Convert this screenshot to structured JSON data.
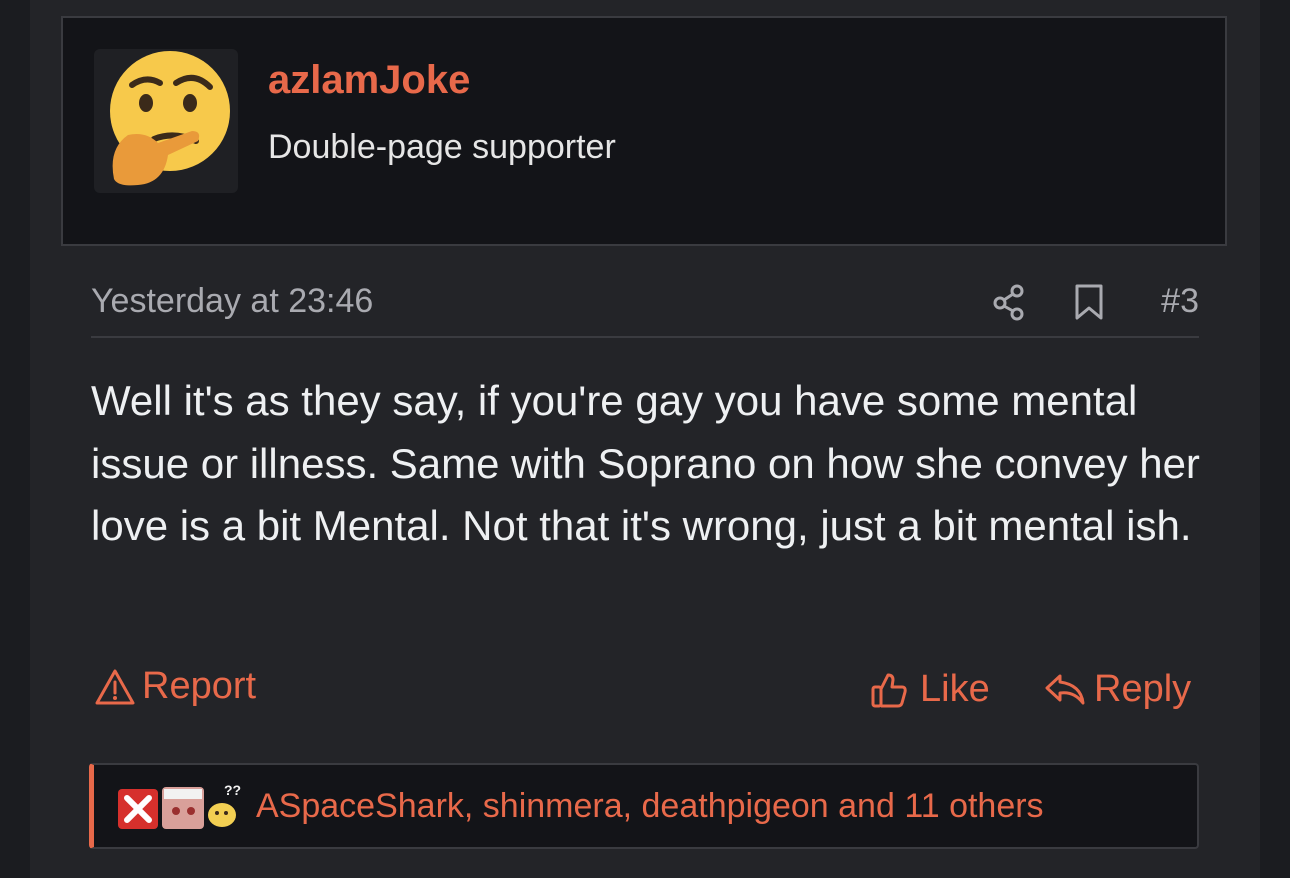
{
  "user": {
    "avatar_icon": "thinking-face-emoji",
    "username": "azlamJoke",
    "title": "Double-page supporter"
  },
  "post": {
    "timestamp": "Yesterday at 23:46",
    "share_icon": "share-icon",
    "bookmark_icon": "bookmark-icon",
    "number": "#3",
    "message": "Well it's as they say, if you're gay you have some mental issue or illness. Same with Soprano on how she convey her love is a bit Mental. Not that it's wrong, just a bit mental ish."
  },
  "actions": {
    "report_label": "Report",
    "like_label": "Like",
    "reply_label": "Reply"
  },
  "reactions": {
    "icons": [
      "red-x-icon",
      "anime-girl-icon",
      "confused-face-icon"
    ],
    "summary": "ASpaceShark, shinmera, deathpigeon and 11 others"
  },
  "colors": {
    "accent": "#e8694a",
    "background": "#232428",
    "panel": "#131418",
    "text": "#eef0f2",
    "muted": "#a9aab0"
  }
}
